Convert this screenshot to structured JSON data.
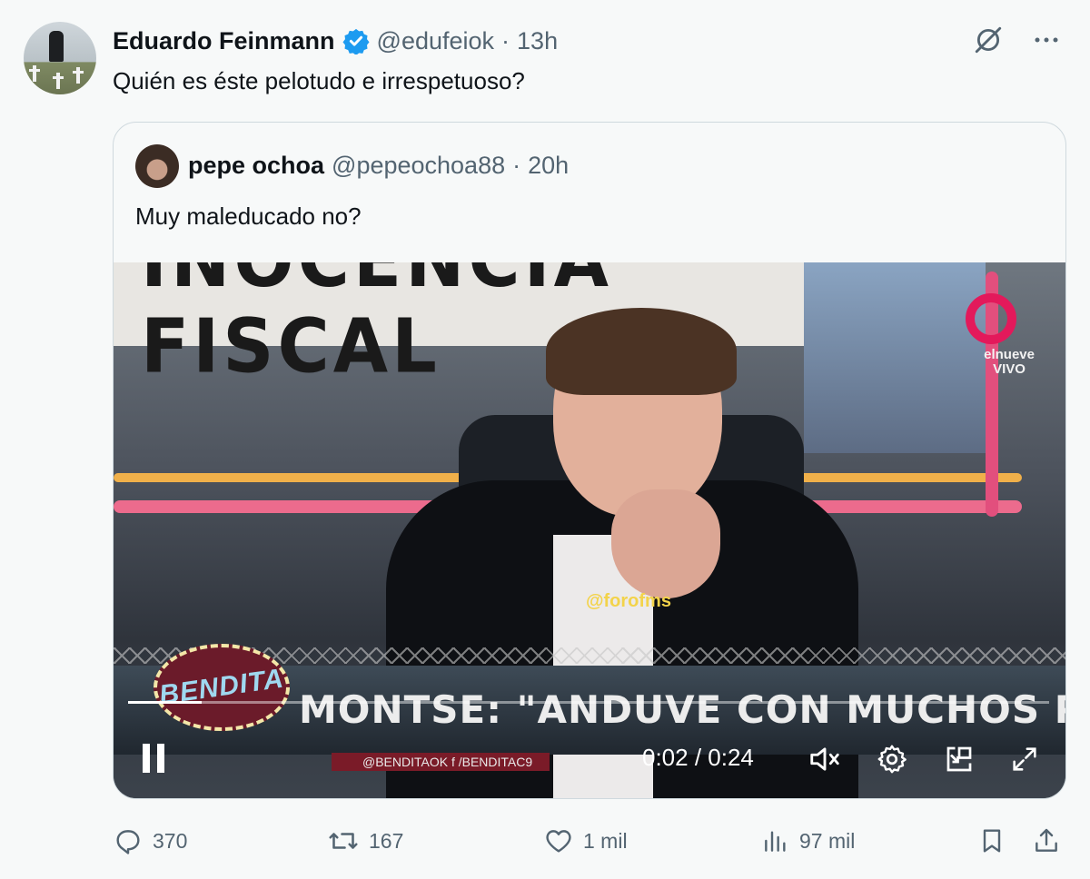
{
  "tweet": {
    "author_name": "Eduardo Feinmann",
    "author_handle": "@edufeiok",
    "separator": "·",
    "time": "13h",
    "text": "Quién es éste pelotudo e irrespetuoso?"
  },
  "quoted": {
    "author_name": "pepe ochoa",
    "author_handle": "@pepeochoa88",
    "separator": "·",
    "time": "20h",
    "text": "Muy maleducado no?"
  },
  "video": {
    "banner_text": "INOCENCIA FISCAL",
    "channel_logo_text": [
      "elnueve",
      "VIVO"
    ],
    "watermark": "@forofms",
    "show_logo": "BENDITA",
    "headline": "MONTSE: \"ANDUVE CON MUCHOS PRODUCTORES\"",
    "social_text": "@BENDITAOK  f  /BENDITAC9",
    "progress_fraction": 0.08,
    "time_display": "0:02 / 0:24"
  },
  "actions": {
    "replies": "370",
    "reposts": "167",
    "likes": "1 mil",
    "views": "97 mil"
  },
  "colors": {
    "verified_blue": "#1d9bf0",
    "muted_text": "#536471",
    "background": "#f7f9f9",
    "border": "#cfd9de"
  },
  "icons": [
    "verified-badge-icon",
    "grok-icon",
    "more-icon",
    "pause-icon",
    "mute-icon",
    "settings-icon",
    "pip-icon",
    "fullscreen-icon",
    "reply-icon",
    "repost-icon",
    "like-icon",
    "views-icon",
    "bookmark-icon",
    "share-icon"
  ]
}
